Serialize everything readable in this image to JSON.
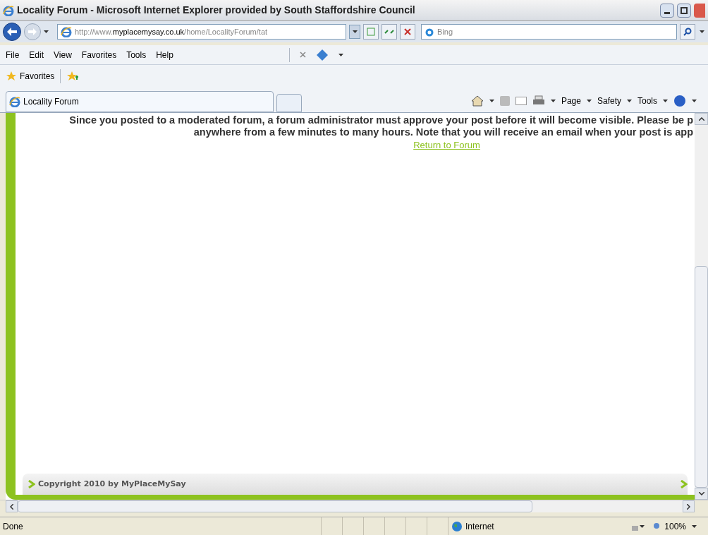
{
  "window": {
    "title": "Locality Forum - Microsoft Internet Explorer provided by South Staffordshire Council"
  },
  "address_bar": {
    "prefix": "http://www.",
    "domain": "myplacemysay.co.uk",
    "path": "/home/LocalityForum/tat"
  },
  "search": {
    "placeholder": "Bing"
  },
  "menu": [
    "File",
    "Edit",
    "View",
    "Favorites",
    "Tools",
    "Help"
  ],
  "favorites_bar": {
    "label": "Favorites"
  },
  "tabs": [
    {
      "label": "Locality Forum",
      "selected": true
    }
  ],
  "command_bar": [
    "Page",
    "Safety",
    "Tools"
  ],
  "content": {
    "message_lines": [
      "Since you posted to a moderated forum, a forum administrator must approve your post before it will become visible. Please be p",
      "anywhere from a few minutes to many hours. Note that you will receive an email when your post is app"
    ],
    "link": "Return to Forum",
    "footer": "Copyright 2010 by MyPlaceMySay"
  },
  "status_bar": {
    "text": "Done",
    "zone": "Internet",
    "zoom": "100%"
  }
}
